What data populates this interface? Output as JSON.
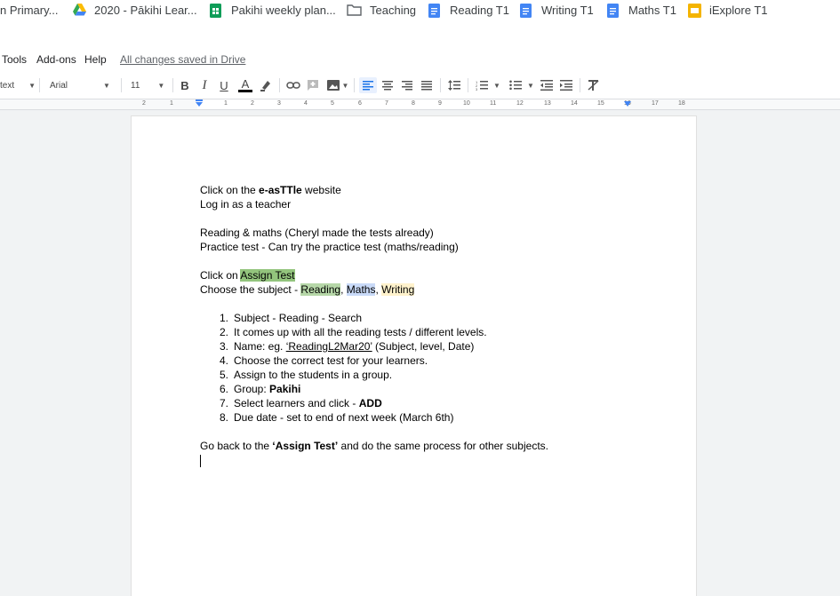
{
  "bookmarks": [
    {
      "label": "n Primary...",
      "icon": "none"
    },
    {
      "label": "2020 - Pākihi Lear...",
      "icon": "drive-icon"
    },
    {
      "label": "Pakihi weekly plan...",
      "icon": "sheets-icon"
    },
    {
      "label": "Teaching",
      "icon": "folder-icon"
    },
    {
      "label": "Reading T1",
      "icon": "docs-icon"
    },
    {
      "label": "Writing T1",
      "icon": "docs-icon"
    },
    {
      "label": "Maths T1",
      "icon": "docs-icon"
    },
    {
      "label": "iExplore T1",
      "icon": "slides-icon"
    }
  ],
  "menu": {
    "items": [
      "Tools",
      "Add-ons",
      "Help"
    ],
    "saved_status": "All changes saved in Drive"
  },
  "toolbar": {
    "style": "text",
    "font": "Arial",
    "size": "11"
  },
  "ruler": {
    "ticks": [
      "2",
      "1",
      "1",
      "2",
      "3",
      "4",
      "5",
      "6",
      "7",
      "8",
      "9",
      "10",
      "11",
      "12",
      "13",
      "14",
      "15",
      "16",
      "17",
      "18"
    ]
  },
  "document": {
    "l1_pre": "Click on the ",
    "l1_bold": "e-asTTle",
    "l1_post": " website",
    "l2": "Log in as a teacher",
    "l3": "Reading & maths (Cheryl made the tests already)",
    "l4": "Practice test - Can try the practice test (maths/reading)",
    "l5_pre": "Click on ",
    "l5_hl": "Assign Test",
    "l6_pre": "Choose the subject - ",
    "l6_reading": "Reading",
    "l6_comma1": ", ",
    "l6_maths": "Maths",
    "l6_comma2": ", ",
    "l6_writing": "Writing",
    "steps": [
      {
        "num": "1.",
        "text": "Subject - Reading - Search"
      },
      {
        "num": "2.",
        "text": "It comes up with all the reading tests / different levels."
      },
      {
        "num": "3.",
        "pre": "Name: eg.  ",
        "link": "‘ReadingL2Mar20’",
        "post": " (Subject, level, Date)"
      },
      {
        "num": "4.",
        "text": "Choose the correct test for your learners."
      },
      {
        "num": "5.",
        "text": "Assign to the students in a group."
      },
      {
        "num": "6.",
        "pre": "Group: ",
        "bold": "Pakihi"
      },
      {
        "num": "7.",
        "pre": "Select learners and click - ",
        "bold": "ADD"
      },
      {
        "num": "8.",
        "text": "Due date - set to end of next week (March 6th)"
      }
    ],
    "last_pre": "Go back to the ",
    "last_bold": "‘Assign Test’",
    "last_post": " and do the same process for other subjects."
  },
  "colors": {
    "highlight_green": "#93c47d",
    "highlight_light_green": "#b6d7a8",
    "highlight_blue": "#c9daf8",
    "highlight_yellow": "#fff2cc",
    "accent_blue": "#1a73e8"
  }
}
